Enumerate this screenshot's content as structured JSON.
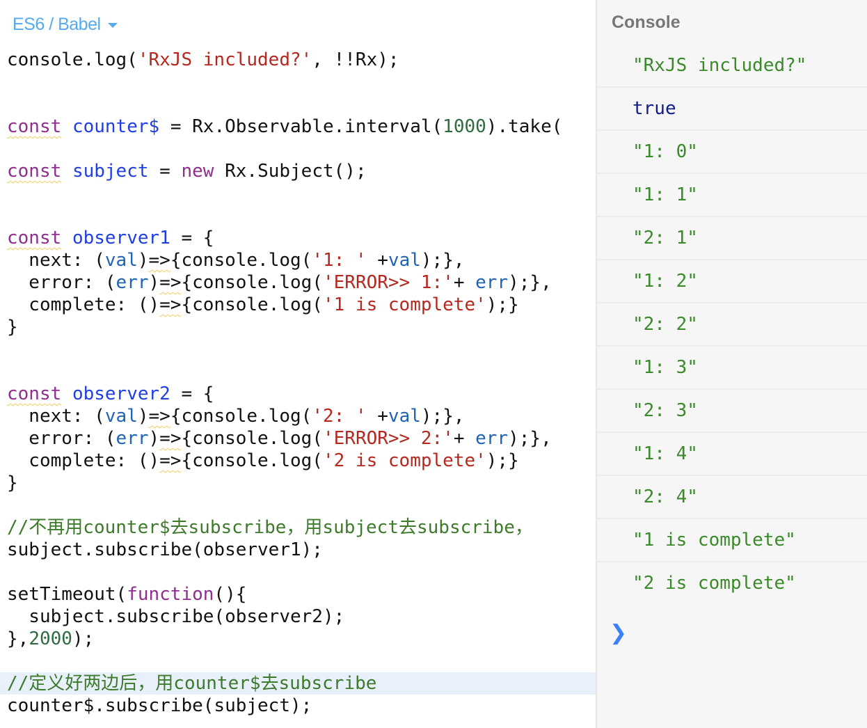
{
  "editor": {
    "language_selector": "ES6 / Babel",
    "lines": [
      [
        {
          "t": "console.log(",
          "c": ""
        },
        {
          "t": "'RxJS included?'",
          "c": "str"
        },
        {
          "t": ", !!Rx);",
          "c": ""
        }
      ],
      [],
      [],
      [
        {
          "t": "const",
          "c": "kw warn"
        },
        {
          "t": " ",
          "c": ""
        },
        {
          "t": "counter$",
          "c": "def"
        },
        {
          "t": " = Rx.Observable.interval(",
          "c": ""
        },
        {
          "t": "1000",
          "c": "num"
        },
        {
          "t": ").take(",
          "c": ""
        }
      ],
      [],
      [
        {
          "t": "const",
          "c": "kw warn"
        },
        {
          "t": " ",
          "c": ""
        },
        {
          "t": "subject",
          "c": "def"
        },
        {
          "t": " = ",
          "c": ""
        },
        {
          "t": "new",
          "c": "kw"
        },
        {
          "t": " Rx.Subject();",
          "c": ""
        }
      ],
      [],
      [],
      [
        {
          "t": "const",
          "c": "kw warn"
        },
        {
          "t": " ",
          "c": ""
        },
        {
          "t": "observer1",
          "c": "def"
        },
        {
          "t": " = {",
          "c": ""
        }
      ],
      [
        {
          "t": "  next: (",
          "c": ""
        },
        {
          "t": "val",
          "c": "var"
        },
        {
          "t": ")",
          "c": ""
        },
        {
          "t": "=>",
          "c": "warn"
        },
        {
          "t": "{console.log(",
          "c": ""
        },
        {
          "t": "'1: '",
          "c": "str"
        },
        {
          "t": " +",
          "c": ""
        },
        {
          "t": "val",
          "c": "var"
        },
        {
          "t": ");},",
          "c": ""
        }
      ],
      [
        {
          "t": "  error: (",
          "c": ""
        },
        {
          "t": "err",
          "c": "var"
        },
        {
          "t": ")",
          "c": ""
        },
        {
          "t": "=>",
          "c": "warn"
        },
        {
          "t": "{console.log(",
          "c": ""
        },
        {
          "t": "'ERROR>> 1:'",
          "c": "str"
        },
        {
          "t": "+ ",
          "c": ""
        },
        {
          "t": "err",
          "c": "var"
        },
        {
          "t": ");},",
          "c": ""
        }
      ],
      [
        {
          "t": "  complete: ()",
          "c": ""
        },
        {
          "t": "=>",
          "c": "warn"
        },
        {
          "t": "{console.log(",
          "c": ""
        },
        {
          "t": "'1 is complete'",
          "c": "str"
        },
        {
          "t": ");}",
          "c": ""
        }
      ],
      [
        {
          "t": "}",
          "c": ""
        }
      ],
      [],
      [],
      [
        {
          "t": "const",
          "c": "kw warn"
        },
        {
          "t": " ",
          "c": ""
        },
        {
          "t": "observer2",
          "c": "def"
        },
        {
          "t": " = {",
          "c": ""
        }
      ],
      [
        {
          "t": "  next: (",
          "c": ""
        },
        {
          "t": "val",
          "c": "var"
        },
        {
          "t": ")",
          "c": ""
        },
        {
          "t": "=>",
          "c": "warn"
        },
        {
          "t": "{console.log(",
          "c": ""
        },
        {
          "t": "'2: '",
          "c": "str"
        },
        {
          "t": " +",
          "c": ""
        },
        {
          "t": "val",
          "c": "var"
        },
        {
          "t": ");},",
          "c": ""
        }
      ],
      [
        {
          "t": "  error: (",
          "c": ""
        },
        {
          "t": "err",
          "c": "var"
        },
        {
          "t": ")",
          "c": ""
        },
        {
          "t": "=>",
          "c": "warn"
        },
        {
          "t": "{console.log(",
          "c": ""
        },
        {
          "t": "'ERROR>> 2:'",
          "c": "str"
        },
        {
          "t": "+ ",
          "c": ""
        },
        {
          "t": "err",
          "c": "var"
        },
        {
          "t": ");},",
          "c": ""
        }
      ],
      [
        {
          "t": "  complete: ()",
          "c": ""
        },
        {
          "t": "=>",
          "c": "warn"
        },
        {
          "t": "{console.log(",
          "c": ""
        },
        {
          "t": "'2 is complete'",
          "c": "str"
        },
        {
          "t": ");}",
          "c": ""
        }
      ],
      [
        {
          "t": "}",
          "c": ""
        }
      ],
      [],
      [
        {
          "t": "//不再用counter$去subscribe，用subject去subscribe，",
          "c": "com"
        }
      ],
      [
        {
          "t": "subject.subscribe(observer1);",
          "c": ""
        }
      ],
      [],
      [
        {
          "t": "setTimeout(",
          "c": ""
        },
        {
          "t": "function",
          "c": "kw"
        },
        {
          "t": "(){",
          "c": ""
        }
      ],
      [
        {
          "t": "  subject.subscribe(observer2);",
          "c": ""
        }
      ],
      [
        {
          "t": "},",
          "c": ""
        },
        {
          "t": "2000",
          "c": "num"
        },
        {
          "t": ");",
          "c": ""
        }
      ],
      [],
      [
        {
          "t": "//定义好两边后，用counter$去subscribe",
          "c": "com"
        }
      ],
      [
        {
          "t": "counter$.subscribe(subject);",
          "c": ""
        }
      ]
    ],
    "highlighted_line": 28
  },
  "console": {
    "title": "Console",
    "entries": [
      {
        "text": "\"RxJS included?\"",
        "type": "string"
      },
      {
        "text": "true",
        "type": "boolean"
      },
      {
        "text": "\"1: 0\"",
        "type": "string"
      },
      {
        "text": "\"1: 1\"",
        "type": "string"
      },
      {
        "text": "\"2: 1\"",
        "type": "string"
      },
      {
        "text": "\"1: 2\"",
        "type": "string"
      },
      {
        "text": "\"2: 2\"",
        "type": "string"
      },
      {
        "text": "\"1: 3\"",
        "type": "string"
      },
      {
        "text": "\"2: 3\"",
        "type": "string"
      },
      {
        "text": "\"1: 4\"",
        "type": "string"
      },
      {
        "text": "\"2: 4\"",
        "type": "string"
      },
      {
        "text": "\"1 is complete\"",
        "type": "string"
      },
      {
        "text": "\"2 is complete\"",
        "type": "string"
      }
    ],
    "prompt_icon": "chevron-right-icon",
    "prompt_glyph": "❯"
  },
  "colors": {
    "language_selector": "#55aaef",
    "keyword": "#8e2f8e",
    "definition": "#1f3ee6",
    "string": "#b5281f",
    "number": "#2e6b3f",
    "comment": "#3d7a2a",
    "console_string": "#3a8a2a",
    "console_boolean": "#0f1e8a",
    "prompt": "#3b82f6"
  }
}
